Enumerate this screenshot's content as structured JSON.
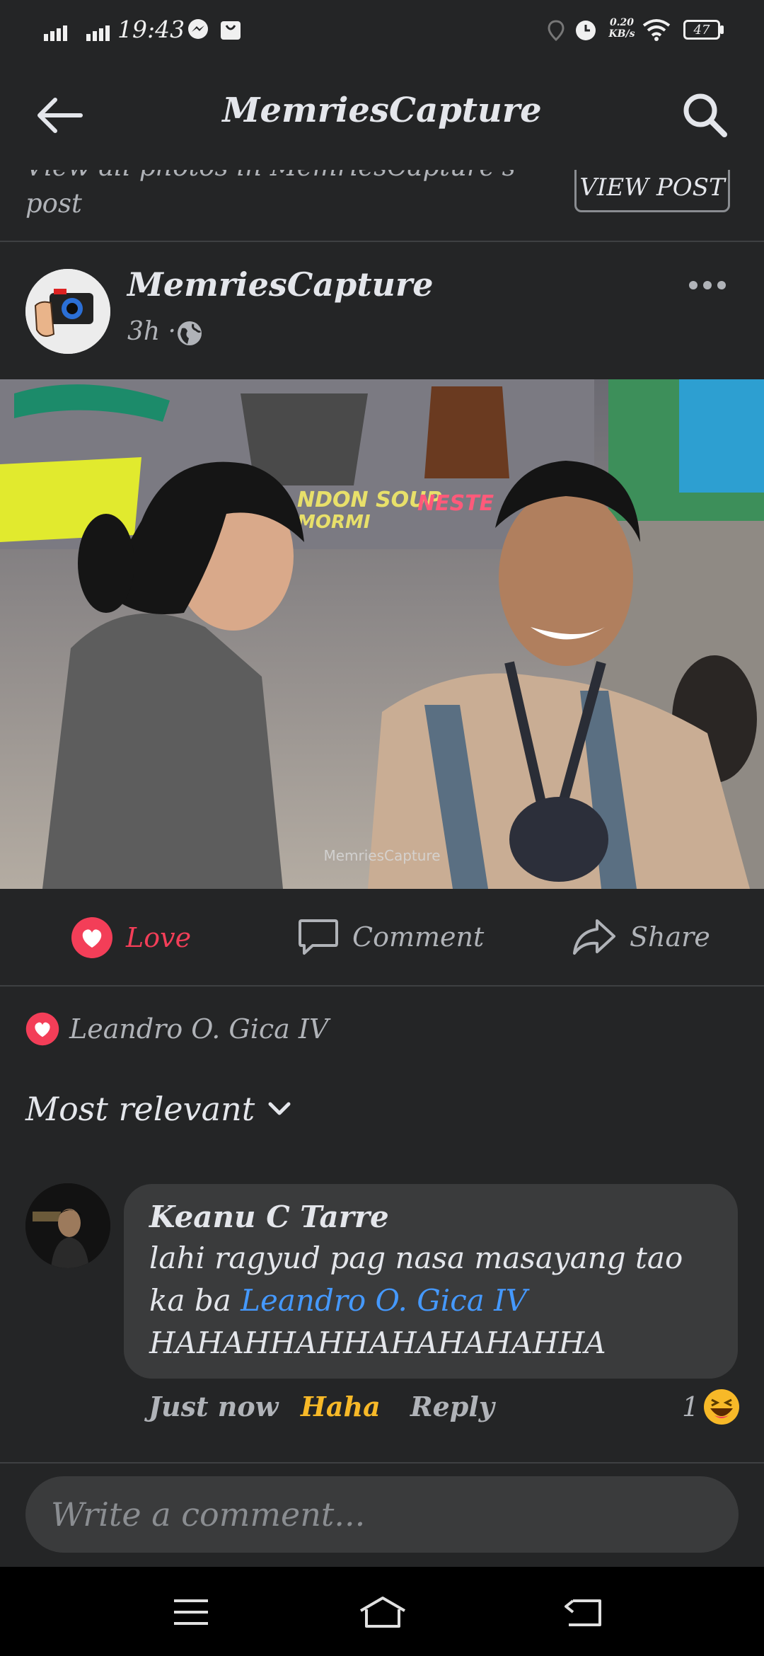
{
  "status_bar": {
    "time": "19:43",
    "net_speed_value": "0.20",
    "net_speed_unit": "KB/s",
    "battery": "47"
  },
  "header": {
    "title": "MemriesCapture"
  },
  "banner": {
    "text": "View all photos in MemriesCapture's post",
    "button": "VIEW POST"
  },
  "post": {
    "author": "MemriesCapture",
    "time": "3h ·",
    "photo_watermark": "MemriesCapture",
    "sign_line1": "NDON SOUP",
    "sign_line2": "MORMI",
    "sign_line3": "NESTE"
  },
  "actions": {
    "love": "Love",
    "comment": "Comment",
    "share": "Share"
  },
  "reactions": {
    "name": "Leandro O. Gica IV"
  },
  "sort": {
    "label": "Most relevant"
  },
  "comment": {
    "name": "Keanu C Tarre",
    "text1": "lahi ragyud pag nasa masayang tao",
    "text2": "ka ba ",
    "mention": "Leandro O. Gica IV",
    "text3": "HAHAHHAHHAHAHAHAHHA",
    "time": "Just now",
    "haha": "Haha",
    "reply": "Reply",
    "reaction_count": "1"
  },
  "composer": {
    "placeholder": "Write a comment..."
  },
  "colors": {
    "background": "#242526",
    "love": "#f33e58",
    "haha": "#f7b928",
    "mention": "#4599ff"
  }
}
